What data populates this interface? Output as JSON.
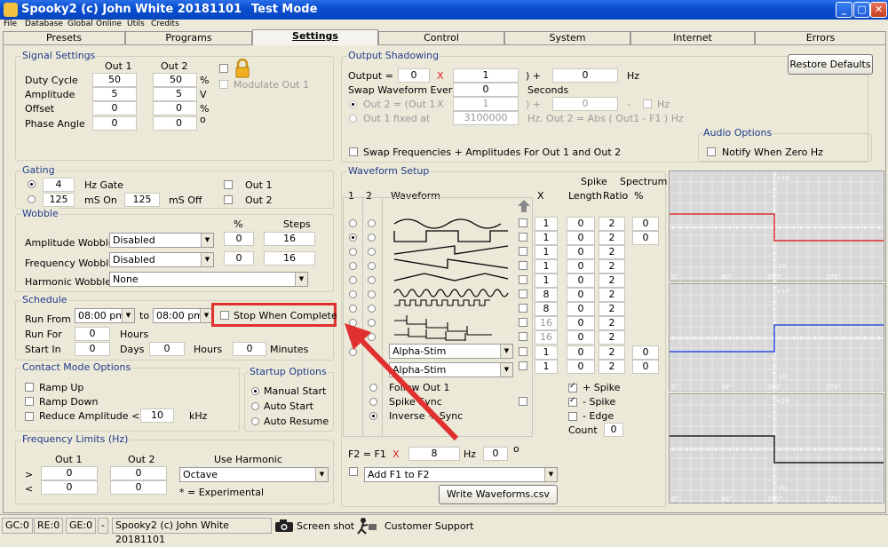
{
  "window": {
    "title": "Spooky2 (c) John White 20181101",
    "mode": "Test Mode",
    "min": "_",
    "max": "▢",
    "close": "✕"
  },
  "menu": [
    "File",
    "Database",
    "Global",
    "Online",
    "Utils",
    "Credits"
  ],
  "tabs": [
    "Presets",
    "Programs",
    "Settings",
    "Control",
    "System",
    "Internet",
    "Errors"
  ],
  "signal": {
    "title": "Signal Settings",
    "out1": "Out 1",
    "out2": "Out 2",
    "rows": [
      {
        "label": "Duty Cycle",
        "v1": "50",
        "v2": "50",
        "unit": "%"
      },
      {
        "label": "Amplitude",
        "v1": "5",
        "v2": "5",
        "unit": "V"
      },
      {
        "label": "Offset",
        "v1": "0",
        "v2": "0",
        "unit": "%"
      },
      {
        "label": "Phase Angle",
        "v1": "0",
        "v2": "0",
        "unit": "o"
      }
    ],
    "modulate": "Modulate Out 1"
  },
  "gating": {
    "title": "Gating",
    "hz_value": "4",
    "hz_label": "Hz Gate",
    "ms_on": "125",
    "ms_on_label": "mS On",
    "ms_off": "125",
    "ms_off_label": "mS Off",
    "out1": "Out 1",
    "out2": "Out 2"
  },
  "wobble": {
    "title": "Wobble",
    "pct": "%",
    "steps": "Steps",
    "rows": [
      {
        "label": "Amplitude Wobble",
        "value": "Disabled",
        "pct": "0",
        "steps": "16"
      },
      {
        "label": "Frequency Wobble",
        "value": "Disabled",
        "pct": "0",
        "steps": "16"
      },
      {
        "label": "Harmonic Wobble",
        "value": "None"
      }
    ]
  },
  "schedule": {
    "title": "Schedule",
    "run_from": "Run From",
    "from": "08:00 pm",
    "to_label": "to",
    "to": "08:00 pm",
    "stop": "Stop When Complete",
    "run_for": "Run For",
    "run_for_val": "0",
    "hours": "Hours",
    "start_in": "Start In",
    "days_val": "0",
    "days": "Days",
    "hours_val": "0",
    "hours2": "Hours",
    "min_val": "0",
    "minutes": "Minutes"
  },
  "contact": {
    "title": "Contact Mode Options",
    "ramp_up": "Ramp Up",
    "ramp_down": "Ramp Down",
    "reduce": "Reduce Amplitude <",
    "reduce_val": "10",
    "khz": "kHz"
  },
  "startup": {
    "title": "Startup Options",
    "manual": "Manual Start",
    "auto_start": "Auto Start",
    "auto_resume": "Auto Resume"
  },
  "freqlimits": {
    "title": "Frequency Limits (Hz)",
    "out1": "Out 1",
    "out2": "Out 2",
    "use_harmonic": "Use Harmonic",
    "gt": ">",
    "lt": "<",
    "o1a": "0",
    "o2a": "0",
    "o1b": "0",
    "o2b": "0",
    "harmonic": "Octave",
    "note": "* = Experimental"
  },
  "shadow": {
    "title": "Output Shadowing",
    "output": "Output =",
    "o_val": "0",
    "x": "X",
    "mult": "1",
    "close_plus": ") +",
    "plus_val": "0",
    "hz": "Hz",
    "swap_every": "Swap Waveform Every",
    "swap_val": "0",
    "seconds": "Seconds",
    "out2eq": "Out 2 = (Out 1",
    "x2": "X",
    "o2mult": "1",
    "o2plus": ") +",
    "o2val": "0",
    "dash": "-",
    "hz2": "Hz",
    "fixed": "Out 1 fixed at",
    "fixed_val": "3100000",
    "hzout2": "Hz. Out 2 = Abs ( Out1 - F1 ) Hz",
    "swapfreq": "Swap Frequencies + Amplitudes For Out 1 and Out 2"
  },
  "restore": "Restore Defaults",
  "audio": {
    "title": "Audio Options",
    "notify": "Notify When Zero Hz"
  },
  "waveform": {
    "title": "Waveform Setup",
    "c1": "1",
    "c2": "2",
    "wave": "Waveform",
    "x": "X",
    "spike": "Spike",
    "spectrum": "Spectrum",
    "length": "Length",
    "ratio": "Ratio",
    "pct": "%",
    "rows": [
      {
        "x": "1",
        "len": "0",
        "ratio": "2",
        "pct": "0"
      },
      {
        "x": "1",
        "len": "0",
        "ratio": "2",
        "pct": "0"
      },
      {
        "x": "1",
        "len": "0",
        "ratio": "2",
        "pct": ""
      },
      {
        "x": "1",
        "len": "0",
        "ratio": "2",
        "pct": ""
      },
      {
        "x": "1",
        "len": "0",
        "ratio": "2",
        "pct": ""
      },
      {
        "x": "8",
        "len": "0",
        "ratio": "2",
        "pct": ""
      },
      {
        "x": "8",
        "len": "0",
        "ratio": "2",
        "pct": ""
      },
      {
        "x": "16",
        "len": "0",
        "ratio": "2",
        "pct": ""
      },
      {
        "x": "16",
        "len": "0",
        "ratio": "2",
        "pct": ""
      },
      {
        "x": "1",
        "len": "0",
        "ratio": "2",
        "pct": "0"
      },
      {
        "x": "1",
        "len": "0",
        "ratio": "2",
        "pct": "0"
      }
    ],
    "alpha1": "Alpha-Stim",
    "alpha2": "Alpha-Stim",
    "follow": "Follow Out 1",
    "spike_sync": "Spike Sync",
    "inverse": "Inverse + Sync",
    "plus_spike": "+ Spike",
    "minus_spike": "- Spike",
    "edge": "- Edge",
    "count": "Count",
    "count_val": "0",
    "f2": "F2 = F1",
    "f2x": "X",
    "f2mult": "8",
    "f2hz": "Hz",
    "f2phase": "0",
    "f2deg": "o",
    "addf": "Add F1 to F2",
    "write": "Write Waveforms.csv"
  },
  "scopes": [
    {
      "top": "+10",
      "bottom": "-10",
      "color": "#e03030"
    },
    {
      "top": "+10",
      "bottom": "-10",
      "color": "#3050e0"
    },
    {
      "top": "+20",
      "bottom": "-20",
      "color": "#202020"
    }
  ],
  "scope_ticks": [
    "0°",
    "90°",
    "180°",
    "270°"
  ],
  "status": {
    "gc": "GC:0",
    "re": "RE:0",
    "ge": "GE:0",
    "dash": "-",
    "title": "Spooky2 (c) John White 20181101",
    "screenshot": "Screen shot",
    "support": "Customer Support"
  }
}
